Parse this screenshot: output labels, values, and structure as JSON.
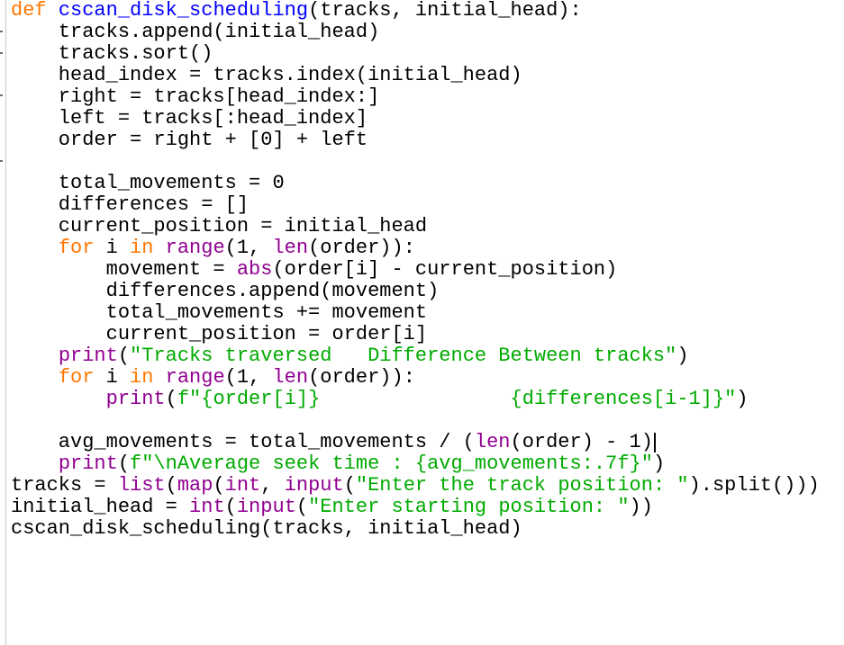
{
  "colors": {
    "keyword": "#ff7700",
    "builtin": "#900090",
    "string": "#00aa00",
    "definition": "#0000ff",
    "default": "#000000"
  },
  "code_lines": [
    [
      {
        "t": "def",
        "c": "kw"
      },
      {
        "t": " "
      },
      {
        "t": "cscan_disk_scheduling",
        "c": "def"
      },
      {
        "t": "(tracks, initial_head):"
      }
    ],
    [
      {
        "t": "    tracks.append(initial_head)"
      }
    ],
    [
      {
        "t": "    tracks.sort()"
      }
    ],
    [
      {
        "t": "    head_index = tracks.index(initial_head)"
      }
    ],
    [
      {
        "t": "    right = tracks[head_index:]"
      }
    ],
    [
      {
        "t": "    left = tracks[:head_index]"
      }
    ],
    [
      {
        "t": "    order = right + [0] + left"
      }
    ],
    [
      {
        "t": ""
      }
    ],
    [
      {
        "t": "    total_movements = 0"
      }
    ],
    [
      {
        "t": "    differences = []"
      }
    ],
    [
      {
        "t": "    current_position = initial_head"
      }
    ],
    [
      {
        "t": "    "
      },
      {
        "t": "for",
        "c": "kw"
      },
      {
        "t": " i "
      },
      {
        "t": "in",
        "c": "kw"
      },
      {
        "t": " "
      },
      {
        "t": "range",
        "c": "bi"
      },
      {
        "t": "(1, "
      },
      {
        "t": "len",
        "c": "bi"
      },
      {
        "t": "(order)):"
      }
    ],
    [
      {
        "t": "        movement = "
      },
      {
        "t": "abs",
        "c": "bi"
      },
      {
        "t": "(order[i] - current_position)"
      }
    ],
    [
      {
        "t": "        differences.append(movement)"
      }
    ],
    [
      {
        "t": "        total_movements += movement"
      }
    ],
    [
      {
        "t": "        current_position = order[i]"
      }
    ],
    [
      {
        "t": "    "
      },
      {
        "t": "print",
        "c": "bi"
      },
      {
        "t": "("
      },
      {
        "t": "\"Tracks traversed   Difference Between tracks\"",
        "c": "str"
      },
      {
        "t": ")"
      }
    ],
    [
      {
        "t": "    "
      },
      {
        "t": "for",
        "c": "kw"
      },
      {
        "t": " i "
      },
      {
        "t": "in",
        "c": "kw"
      },
      {
        "t": " "
      },
      {
        "t": "range",
        "c": "bi"
      },
      {
        "t": "(1, "
      },
      {
        "t": "len",
        "c": "bi"
      },
      {
        "t": "(order)):"
      }
    ],
    [
      {
        "t": "        "
      },
      {
        "t": "print",
        "c": "bi"
      },
      {
        "t": "("
      },
      {
        "t": "f\"{order[i]}                {differences[i-1]}\"",
        "c": "str"
      },
      {
        "t": ")"
      }
    ],
    [
      {
        "t": ""
      }
    ],
    [
      {
        "t": "    avg_movements = total_movements / ("
      },
      {
        "t": "len",
        "c": "bi"
      },
      {
        "t": "(order) - 1)"
      }
    ],
    [
      {
        "t": "    "
      },
      {
        "t": "print",
        "c": "bi"
      },
      {
        "t": "("
      },
      {
        "t": "f\"\\nAverage seek time : {avg_movements:.7f}\"",
        "c": "str"
      },
      {
        "t": ")"
      }
    ],
    [
      {
        "t": "tracks = "
      },
      {
        "t": "list",
        "c": "bi"
      },
      {
        "t": "("
      },
      {
        "t": "map",
        "c": "bi"
      },
      {
        "t": "("
      },
      {
        "t": "int",
        "c": "bi"
      },
      {
        "t": ", "
      },
      {
        "t": "input",
        "c": "bi"
      },
      {
        "t": "("
      },
      {
        "t": "\"Enter the track position: \"",
        "c": "str"
      },
      {
        "t": ").split()))"
      }
    ],
    [
      {
        "t": "initial_head = "
      },
      {
        "t": "int",
        "c": "bi"
      },
      {
        "t": "("
      },
      {
        "t": "input",
        "c": "bi"
      },
      {
        "t": "("
      },
      {
        "t": "\"Enter starting position: \"",
        "c": "str"
      },
      {
        "t": "))"
      }
    ],
    [
      {
        "t": "cscan_disk_scheduling(tracks, initial_head)"
      }
    ]
  ]
}
